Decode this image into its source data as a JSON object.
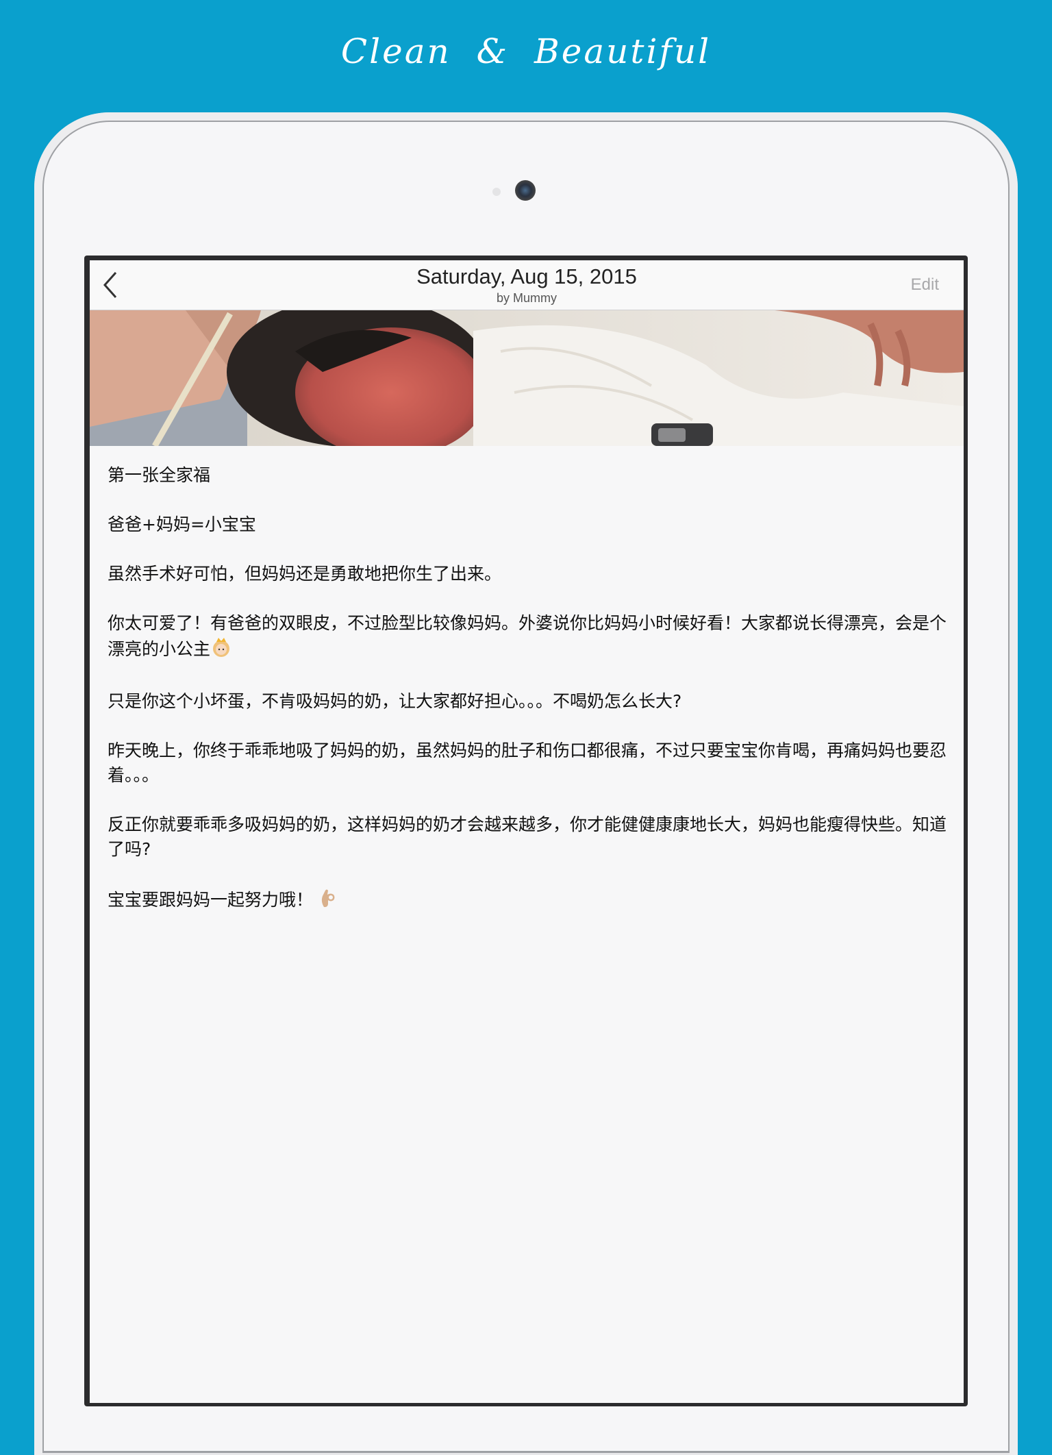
{
  "promo": {
    "title": "Clean & Beautiful"
  },
  "navbar": {
    "title": "Saturday, Aug 15, 2015",
    "subtitle": "by Mummy",
    "edit_label": "Edit"
  },
  "entry": {
    "paragraphs": [
      "第一张全家福",
      "爸爸+妈妈=小宝宝",
      "虽然手术好可怕，但妈妈还是勇敢地把你生了出来。",
      "你太可爱了！有爸爸的双眼皮，不过脸型比较像妈妈。外婆说你比妈妈小时候好看！大家都说长得漂亮，会是个漂亮的小公主",
      "只是你这个小坏蛋，不肯吸妈妈的奶，让大家都好担心。。。不喝奶怎么长大?",
      "昨天晚上，你终于乖乖地吸了妈妈的奶，虽然妈妈的肚子和伤口都很痛，不过只要宝宝你肯喝，再痛妈妈也要忍着。。。",
      "反正你就要乖乖多吸妈妈的奶，这样妈妈的奶才会越来越多，你才能健健康康地长大，妈妈也能瘦得快些。知道了吗?",
      "宝宝要跟妈妈一起努力哦！"
    ],
    "emojis": {
      "princess": "princess-emoji",
      "ok_hand": "ok-hand-emoji"
    }
  },
  "colors": {
    "background": "#0aa0cd",
    "screen": "#f7f7f8",
    "edit": "#a8a8aa"
  }
}
